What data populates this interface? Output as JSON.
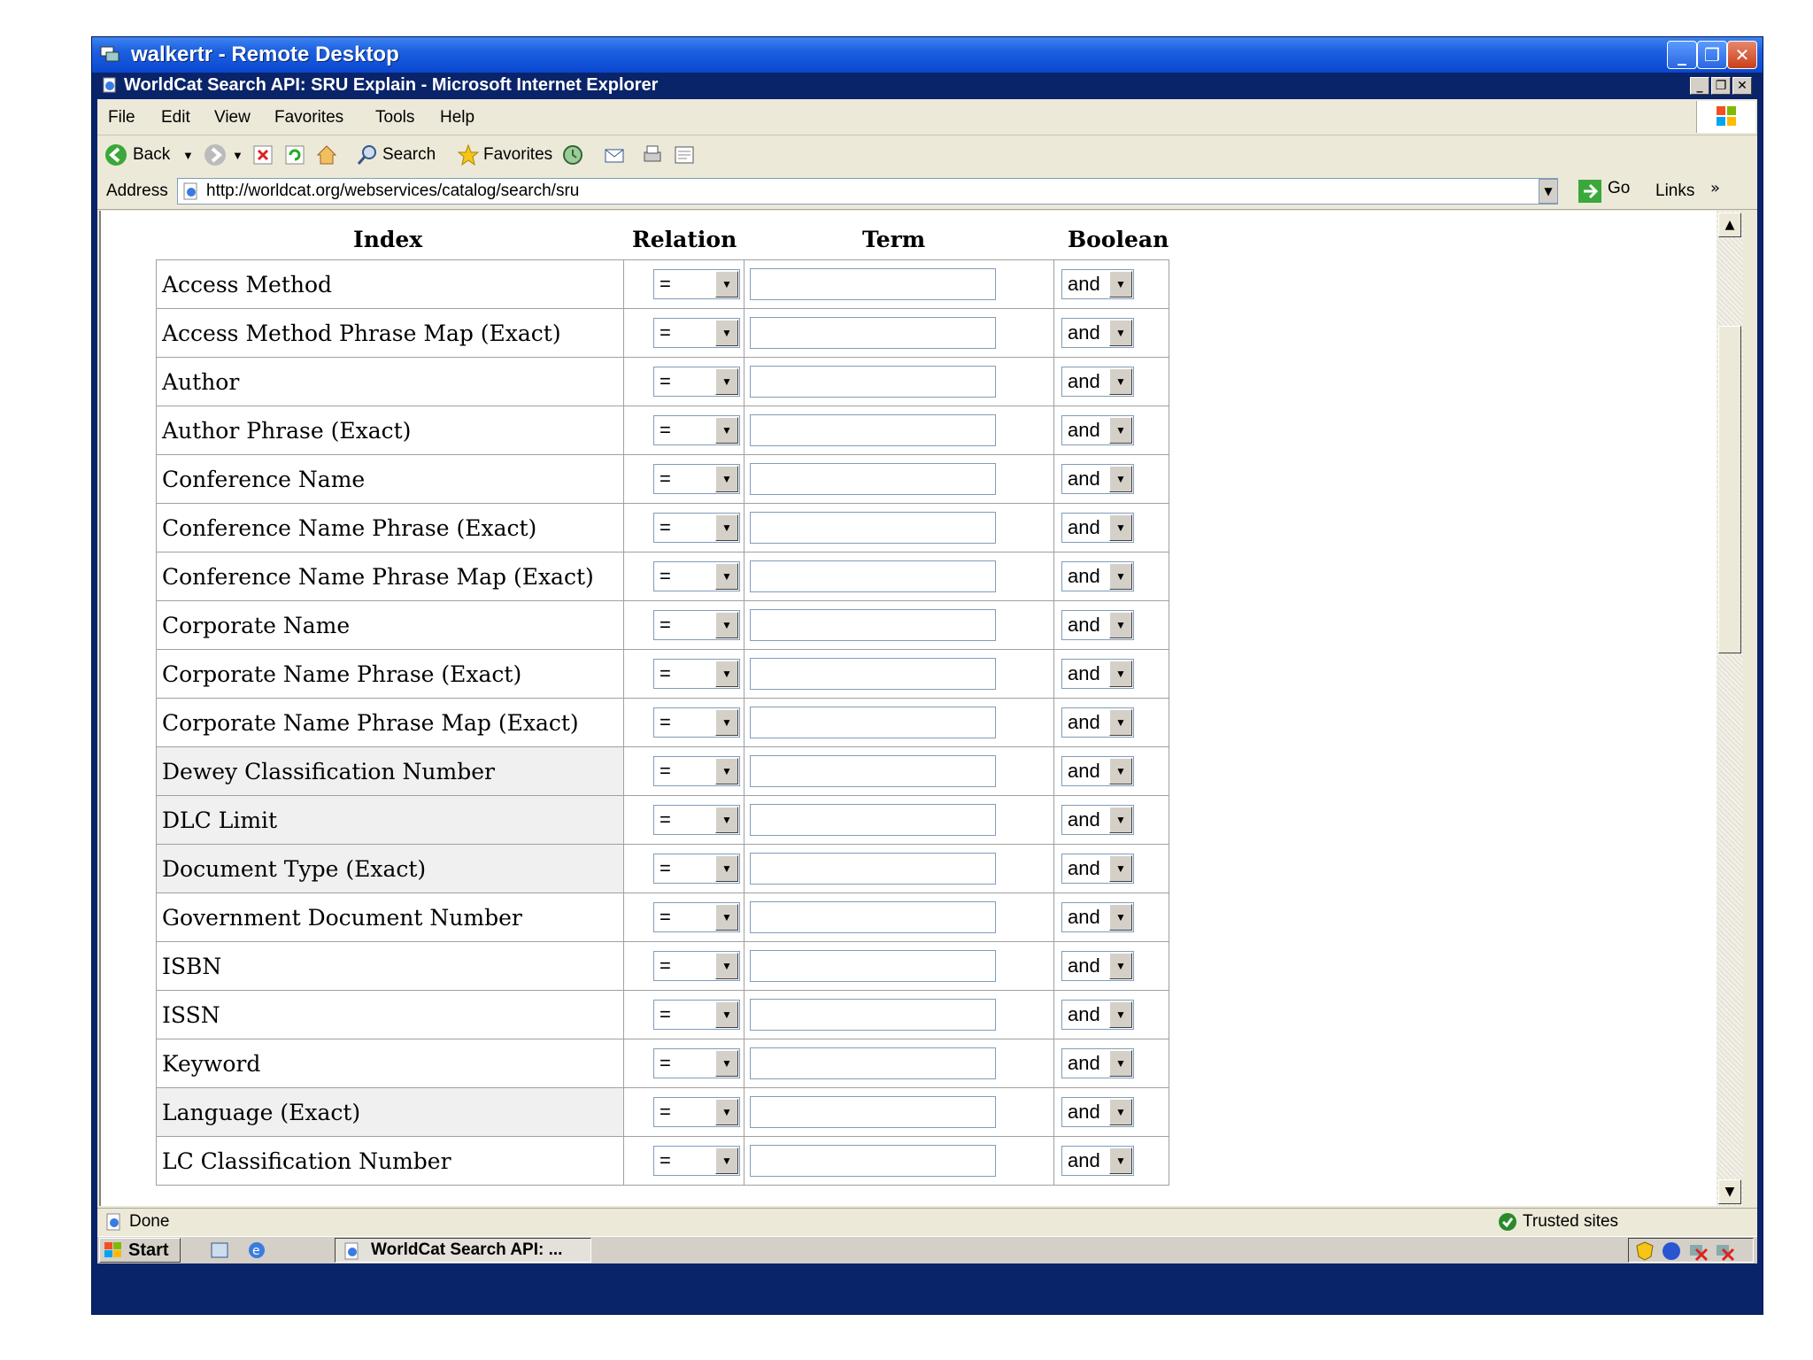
{
  "rdp": {
    "title": "walkertr - Remote Desktop"
  },
  "ie": {
    "title": "WorldCat Search API: SRU Explain - Microsoft Internet Explorer",
    "menu": [
      "File",
      "Edit",
      "View",
      "Favorites",
      "Tools",
      "Help"
    ],
    "toolbar": {
      "back": "Back",
      "search": "Search",
      "favorites": "Favorites"
    },
    "address_label": "Address",
    "url": "http://worldcat.org/webservices/catalog/search/sru",
    "go": "Go",
    "links": "Links"
  },
  "table": {
    "headers": {
      "index": "Index",
      "relation": "Relation",
      "term": "Term",
      "boolean": "Boolean"
    },
    "rows": [
      {
        "index": "Access Method",
        "relation": "=",
        "boolean": "and",
        "shaded": false
      },
      {
        "index": "Access Method Phrase Map (Exact)",
        "relation": "=",
        "boolean": "and",
        "shaded": false
      },
      {
        "index": "Author",
        "relation": "=",
        "boolean": "and",
        "shaded": false
      },
      {
        "index": "Author Phrase (Exact)",
        "relation": "=",
        "boolean": "and",
        "shaded": false
      },
      {
        "index": "Conference Name",
        "relation": "=",
        "boolean": "and",
        "shaded": false
      },
      {
        "index": "Conference Name Phrase (Exact)",
        "relation": "=",
        "boolean": "and",
        "shaded": false
      },
      {
        "index": "Conference Name Phrase Map (Exact)",
        "relation": "=",
        "boolean": "and",
        "shaded": false
      },
      {
        "index": "Corporate Name",
        "relation": "=",
        "boolean": "and",
        "shaded": false
      },
      {
        "index": "Corporate Name Phrase (Exact)",
        "relation": "=",
        "boolean": "and",
        "shaded": false
      },
      {
        "index": "Corporate Name Phrase Map (Exact)",
        "relation": "=",
        "boolean": "and",
        "shaded": false
      },
      {
        "index": "Dewey Classification Number",
        "relation": "=",
        "boolean": "and",
        "shaded": true
      },
      {
        "index": "DLC Limit",
        "relation": "=",
        "boolean": "and",
        "shaded": true
      },
      {
        "index": "Document Type (Exact)",
        "relation": "=",
        "boolean": "and",
        "shaded": true
      },
      {
        "index": "Government Document Number",
        "relation": "=",
        "boolean": "and",
        "shaded": false
      },
      {
        "index": "ISBN",
        "relation": "=",
        "boolean": "and",
        "shaded": false
      },
      {
        "index": "ISSN",
        "relation": "=",
        "boolean": "and",
        "shaded": false
      },
      {
        "index": "Keyword",
        "relation": "=",
        "boolean": "and",
        "shaded": false
      },
      {
        "index": "Language (Exact)",
        "relation": "=",
        "boolean": "and",
        "shaded": true
      },
      {
        "index": "LC Classification Number",
        "relation": "=",
        "boolean": "and",
        "shaded": false
      }
    ]
  },
  "status": {
    "text": "Done",
    "zone": "Trusted sites"
  },
  "taskbar": {
    "start": "Start",
    "task": "WorldCat Search API: ..."
  },
  "colors": {
    "xp_blue": "#0a246a",
    "chrome": "#ece9d8",
    "row_shade": "#f0f0f0"
  }
}
